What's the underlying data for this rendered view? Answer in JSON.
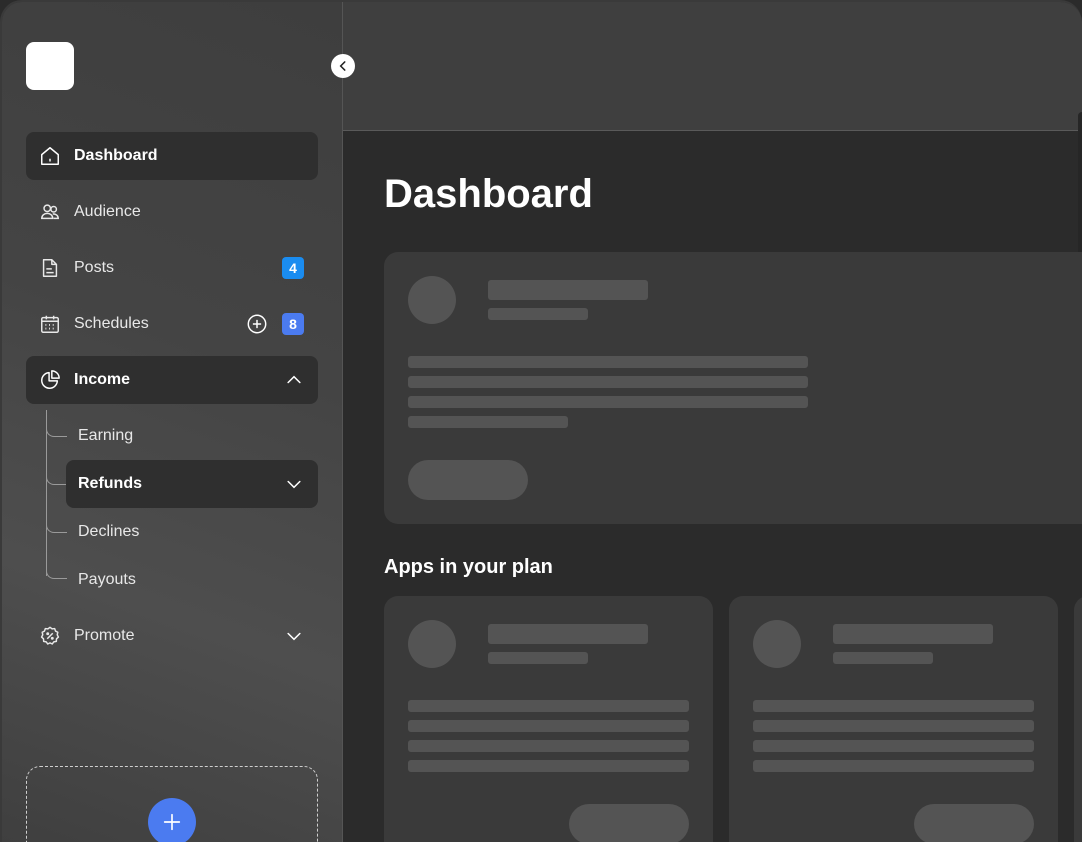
{
  "sidebar": {
    "collapse_icon": "chevron-left-icon",
    "items": [
      {
        "label": "Dashboard",
        "icon": "home-icon"
      },
      {
        "label": "Audience",
        "icon": "users-icon"
      },
      {
        "label": "Posts",
        "icon": "document-icon",
        "badge": "4",
        "badge_color": "#1a8cf0"
      },
      {
        "label": "Schedules",
        "icon": "calendar-icon",
        "badge": "8",
        "badge_color": "#4b7bf0"
      },
      {
        "label": "Income",
        "icon": "pie-chart-icon"
      },
      {
        "label": "Promote",
        "icon": "badge-percent-icon"
      }
    ],
    "income_subitems": [
      "Earning",
      "Refunds",
      "Declines",
      "Payouts"
    ]
  },
  "main": {
    "page_title": "Dashboard",
    "apps_section_title": "Apps in your plan"
  },
  "colors": {
    "accent": "#4b7bf0",
    "posts_badge": "#1a8cf0"
  }
}
